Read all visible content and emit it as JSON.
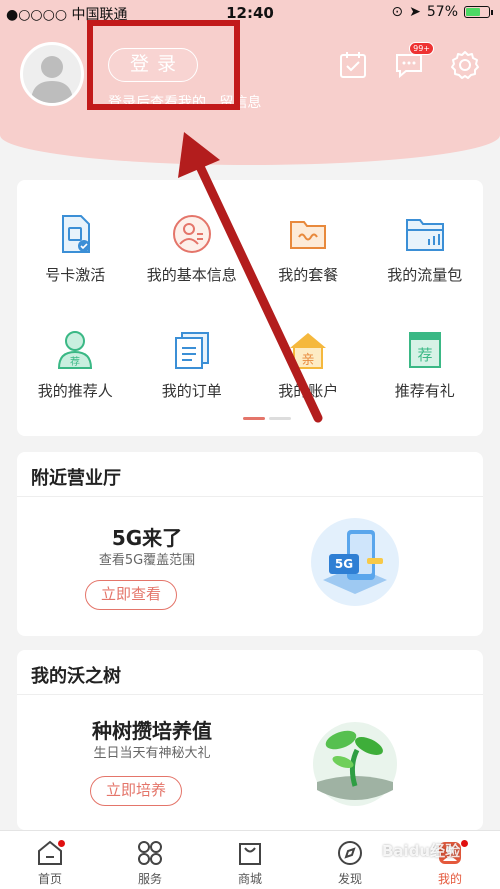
{
  "status_bar": {
    "carrier": "●○○○○ 中国联通",
    "time": "12:40",
    "battery": "57%",
    "battery_level": 0.57
  },
  "header": {
    "login_label": "登录",
    "login_hint": "登录后查看我的...留信息",
    "message_badge": "99+"
  },
  "services": {
    "items": [
      {
        "label": "号卡激活",
        "icon": "sim-card-icon"
      },
      {
        "label": "我的基本信息",
        "icon": "profile-info-icon"
      },
      {
        "label": "我的套餐",
        "icon": "package-icon"
      },
      {
        "label": "我的流量包",
        "icon": "data-folder-icon"
      },
      {
        "label": "我的推荐人",
        "icon": "referrer-icon"
      },
      {
        "label": "我的订单",
        "icon": "orders-icon"
      },
      {
        "label": "我的账户",
        "icon": "account-icon",
        "icon_text": "亲"
      },
      {
        "label": "推荐有礼",
        "icon": "referral-gift-icon",
        "icon_text": "荐"
      }
    ],
    "referrer_icon_text": "荐"
  },
  "nearby": {
    "title": "附近营业厅",
    "promo_title": "5G来了",
    "promo_sub": "查看5G覆盖范围",
    "button": "立即查看",
    "illus_text": "5G"
  },
  "tree": {
    "title": "我的沃之树",
    "promo_title": "种树攒培养值",
    "promo_sub": "生日当天有神秘大礼",
    "button": "立即培养"
  },
  "nav": [
    {
      "label": "首页",
      "icon": "home-icon"
    },
    {
      "label": "服务",
      "icon": "services-icon"
    },
    {
      "label": "商城",
      "icon": "shop-bag-icon"
    },
    {
      "label": "发现",
      "icon": "compass-icon"
    },
    {
      "label": "我的",
      "icon": "mine-icon"
    }
  ],
  "watermark": "Baidu经验",
  "colors": {
    "accent": "#e4756a",
    "header_bg": "#f7cfcc",
    "highlight": "#c21a1a",
    "nav_active": "#e4593c"
  }
}
